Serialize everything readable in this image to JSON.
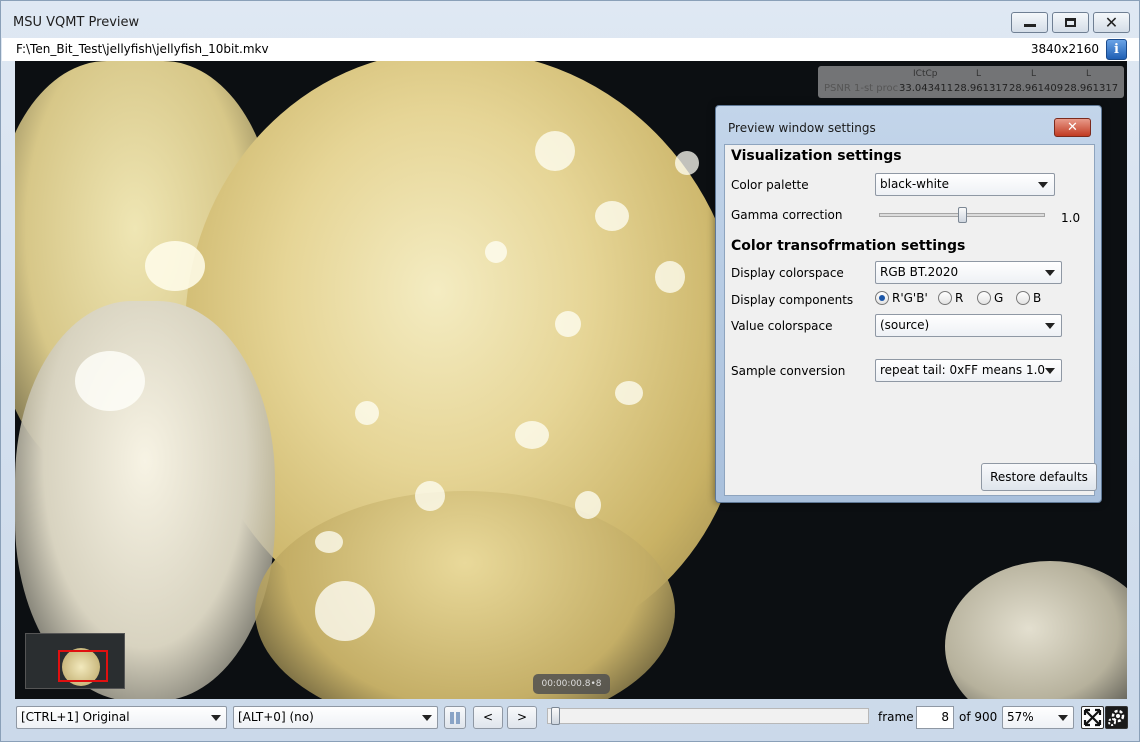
{
  "window": {
    "title": "MSU VQMT Preview"
  },
  "file": {
    "path": "F:\\Ten_Bit_Test\\jellyfish\\jellyfish_10bit.mkv",
    "resolution": "3840x2160"
  },
  "overlay": {
    "headers": [
      "ICtCp",
      "L",
      "L",
      "L"
    ],
    "metric_label": "PSNR 1-st proc",
    "values": [
      "33.043411",
      "28.961317",
      "28.961409",
      "28.961317"
    ]
  },
  "timestamp": "00:00:00.8•8",
  "toolbar": {
    "left_combo": "[CTRL+1] Original",
    "right_combo": "[ALT+0] (no)",
    "prev_label": "<",
    "next_label": ">",
    "frame_label": "frame",
    "frame_value": "8",
    "frame_total": "of 900",
    "zoom": "57%",
    "seek_position": 0.009
  },
  "dialog": {
    "title": "Preview window settings",
    "close_label": "✕",
    "visualization": {
      "heading": "Visualization settings",
      "palette_label": "Color palette",
      "palette_value": "black-white",
      "gamma_label": "Gamma correction",
      "gamma_value": "1.0",
      "gamma_position": 0.5
    },
    "color_transform": {
      "heading": "Color transofrmation settings",
      "display_colorspace_label": "Display colorspace",
      "display_colorspace_value": "RGB BT.2020",
      "components_label": "Display components",
      "components": [
        {
          "label": "R'G'B'",
          "selected": true
        },
        {
          "label": "R",
          "selected": false
        },
        {
          "label": "G",
          "selected": false
        },
        {
          "label": "B",
          "selected": false
        }
      ],
      "value_colorspace_label": "Value colorspace",
      "value_colorspace_value": "(source)"
    },
    "sample_conversion_label": "Sample conversion",
    "sample_conversion_value": "repeat tail: 0xFF means 1.0",
    "restore_label": "Restore defaults"
  },
  "colors": {
    "accent": "#1f5fb4",
    "close_red": "#c13b22",
    "selection_red": "#e01010"
  }
}
